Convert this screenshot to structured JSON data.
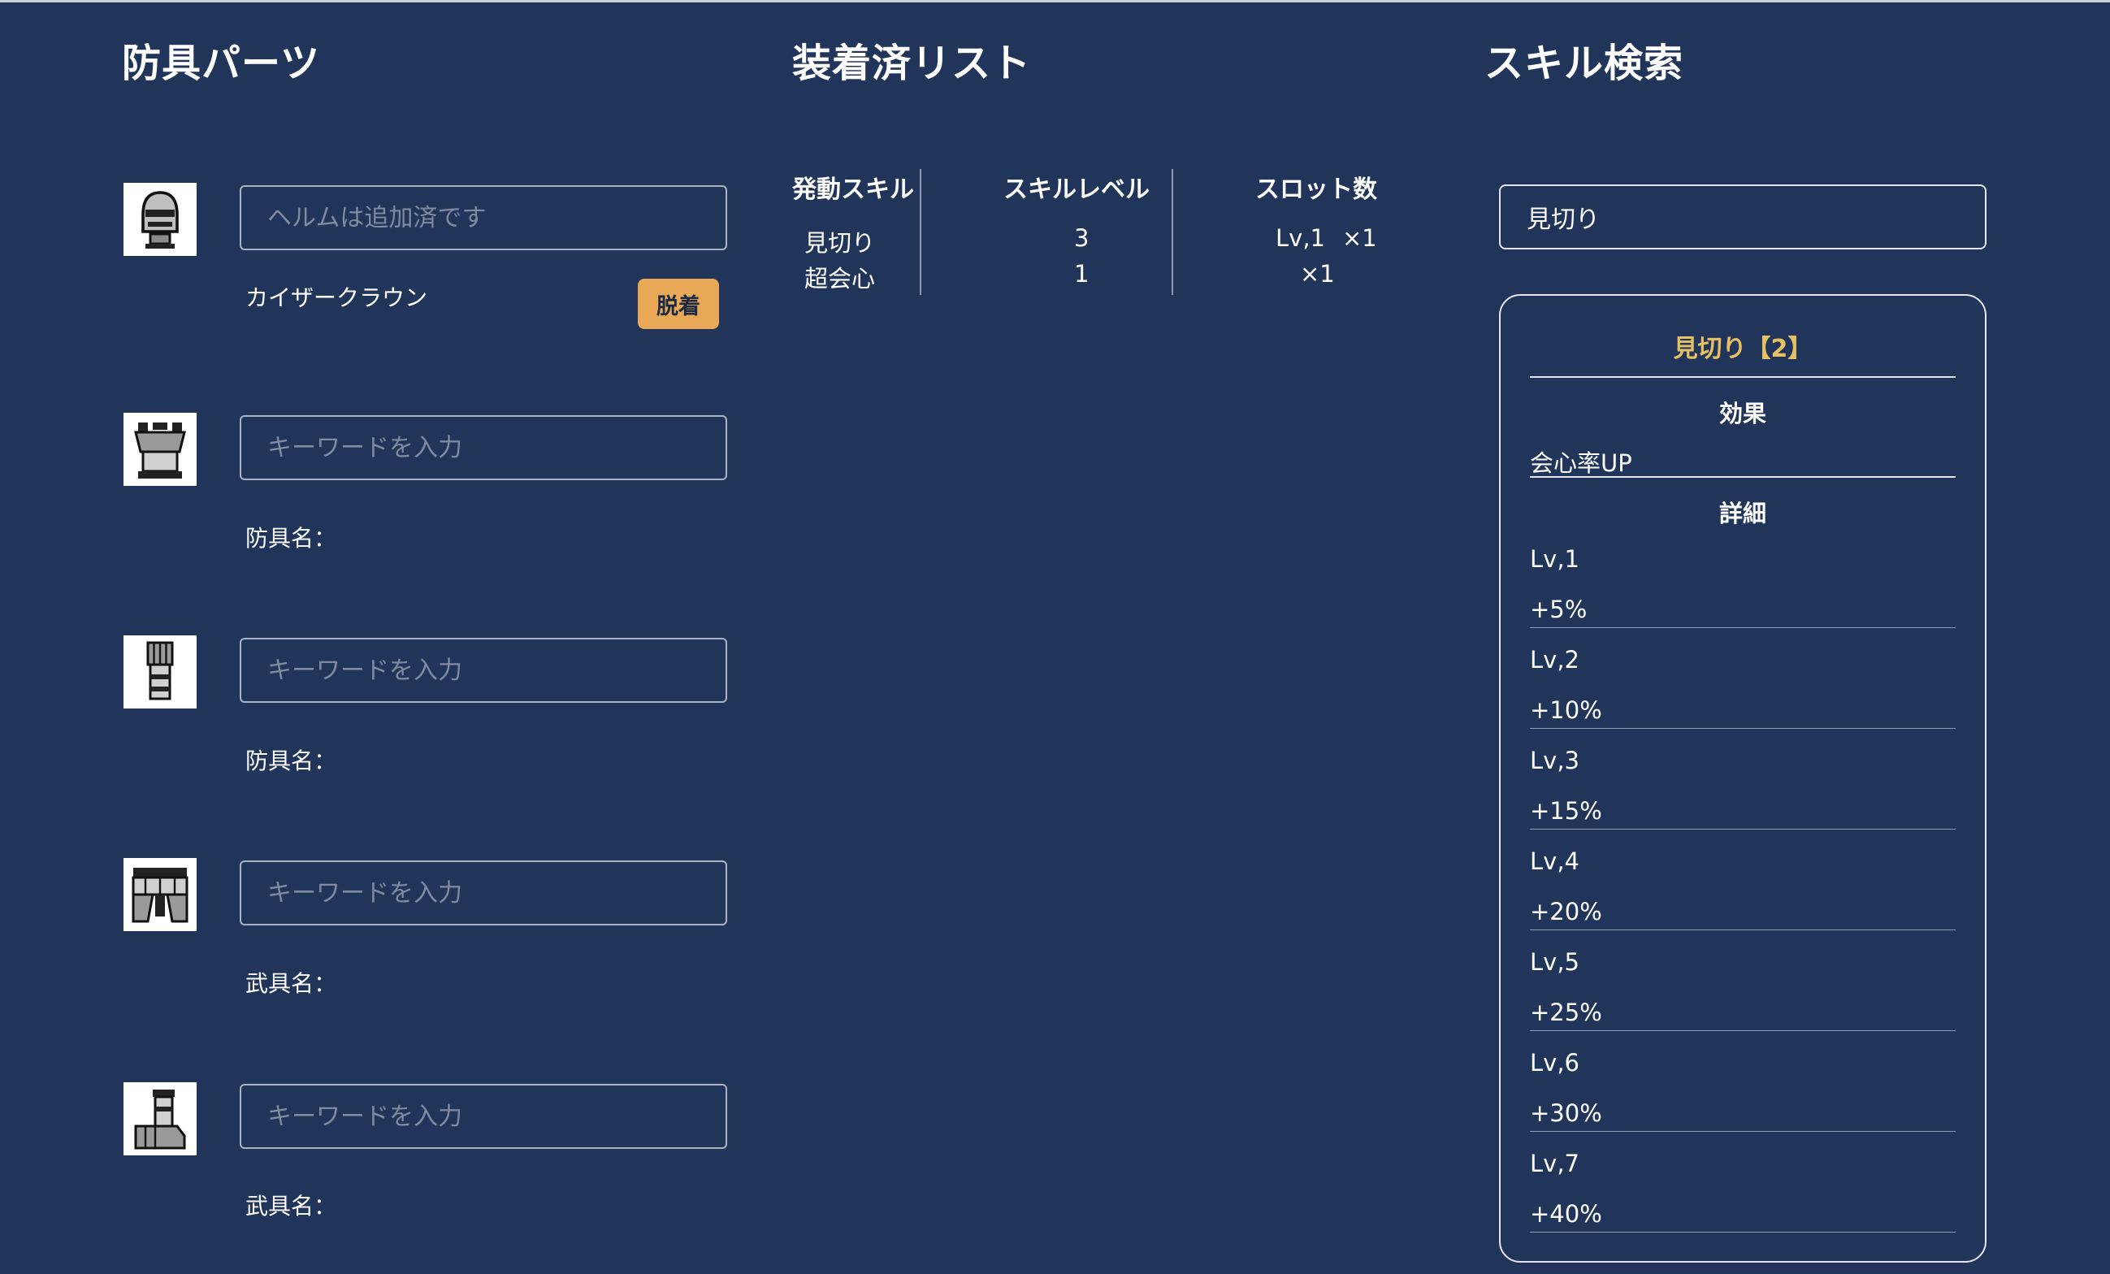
{
  "columns": {
    "armor": "防具パーツ",
    "equipped": "装着済リスト",
    "search": "スキル検索"
  },
  "armor": {
    "name_label": "防具名：",
    "weapon_label": "武具名：",
    "remove_label": "脱着",
    "slots": [
      {
        "icon": "helmet-icon",
        "placeholder": "ヘルムは追加済です",
        "equipped": "カイザークラウン"
      },
      {
        "icon": "chest-armor-icon",
        "placeholder": "キーワードを入力"
      },
      {
        "icon": "gauntlet-icon",
        "placeholder": "キーワードを入力"
      },
      {
        "icon": "waist-armor-icon",
        "placeholder": "キーワードを入力"
      },
      {
        "icon": "boots-icon",
        "placeholder": "キーワードを入力"
      }
    ]
  },
  "equipped": {
    "headers": [
      "発動スキル",
      "スキルレベル",
      "スロット数"
    ],
    "rows": [
      {
        "skill": "見切り",
        "level": "3",
        "slot_lv": "Lv,1",
        "slot_count": "×1"
      },
      {
        "skill": "超会心",
        "level": "1",
        "slot_lv": "",
        "slot_count": "×1"
      }
    ]
  },
  "search": {
    "value": "見切り",
    "card": {
      "title": "見切り【2】",
      "effect_heading": "効果",
      "effect": "会心率UP",
      "detail_heading": "詳細",
      "levels": [
        {
          "lv": "Lv,1",
          "value": "+5%"
        },
        {
          "lv": "Lv,2",
          "value": "+10%"
        },
        {
          "lv": "Lv,3",
          "value": "+15%"
        },
        {
          "lv": "Lv,4",
          "value": "+20%"
        },
        {
          "lv": "Lv,5",
          "value": "+25%"
        },
        {
          "lv": "Lv,6",
          "value": "+30%"
        },
        {
          "lv": "Lv,7",
          "value": "+40%"
        }
      ]
    }
  },
  "colors": {
    "background": "#21355a",
    "accent_button": "#e8a856",
    "card_title": "#e6c063"
  }
}
